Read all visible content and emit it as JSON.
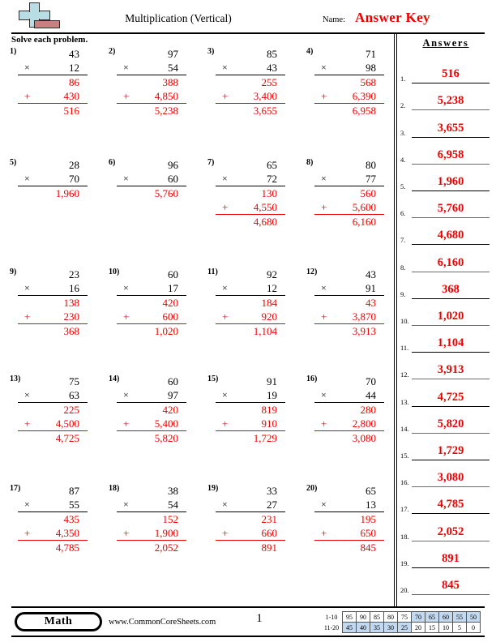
{
  "header": {
    "title": "Multiplication (Vertical)",
    "name_label": "Name:",
    "name_value": "Answer Key",
    "instructions": "Solve each problem.",
    "logo_icon": "plus-block-logo"
  },
  "answers_panel": {
    "title": "Answers",
    "items": [
      {
        "index": "1.",
        "value": "516"
      },
      {
        "index": "2.",
        "value": "5,238"
      },
      {
        "index": "3.",
        "value": "3,655"
      },
      {
        "index": "4.",
        "value": "6,958"
      },
      {
        "index": "5.",
        "value": "1,960"
      },
      {
        "index": "6.",
        "value": "5,760"
      },
      {
        "index": "7.",
        "value": "4,680"
      },
      {
        "index": "8.",
        "value": "6,160"
      },
      {
        "index": "9.",
        "value": "368"
      },
      {
        "index": "10.",
        "value": "1,020"
      },
      {
        "index": "11.",
        "value": "1,104"
      },
      {
        "index": "12.",
        "value": "3,913"
      },
      {
        "index": "13.",
        "value": "4,725"
      },
      {
        "index": "14.",
        "value": "5,820"
      },
      {
        "index": "15.",
        "value": "1,729"
      },
      {
        "index": "16.",
        "value": "3,080"
      },
      {
        "index": "17.",
        "value": "4,785"
      },
      {
        "index": "18.",
        "value": "2,052"
      },
      {
        "index": "19.",
        "value": "891"
      },
      {
        "index": "20.",
        "value": "845"
      }
    ]
  },
  "problems": [
    {
      "num": "1)",
      "multiplicand": "43",
      "operator": "×",
      "multiplier": "12",
      "partials": [
        "86",
        "430"
      ],
      "product": "516"
    },
    {
      "num": "2)",
      "multiplicand": "97",
      "operator": "×",
      "multiplier": "54",
      "partials": [
        "388",
        "4,850"
      ],
      "product": "5,238"
    },
    {
      "num": "3)",
      "multiplicand": "85",
      "operator": "×",
      "multiplier": "43",
      "partials": [
        "255",
        "3,400"
      ],
      "product": "3,655"
    },
    {
      "num": "4)",
      "multiplicand": "71",
      "operator": "×",
      "multiplier": "98",
      "partials": [
        "568",
        "6,390"
      ],
      "product": "6,958"
    },
    {
      "num": "5)",
      "multiplicand": "28",
      "operator": "×",
      "multiplier": "70",
      "partials": [],
      "product": "1,960"
    },
    {
      "num": "6)",
      "multiplicand": "96",
      "operator": "×",
      "multiplier": "60",
      "partials": [],
      "product": "5,760"
    },
    {
      "num": "7)",
      "multiplicand": "65",
      "operator": "×",
      "multiplier": "72",
      "partials": [
        "130",
        "4,550"
      ],
      "product": "4,680"
    },
    {
      "num": "8)",
      "multiplicand": "80",
      "operator": "×",
      "multiplier": "77",
      "partials": [
        "560",
        "5,600"
      ],
      "product": "6,160"
    },
    {
      "num": "9)",
      "multiplicand": "23",
      "operator": "×",
      "multiplier": "16",
      "partials": [
        "138",
        "230"
      ],
      "product": "368"
    },
    {
      "num": "10)",
      "multiplicand": "60",
      "operator": "×",
      "multiplier": "17",
      "partials": [
        "420",
        "600"
      ],
      "product": "1,020"
    },
    {
      "num": "11)",
      "multiplicand": "92",
      "operator": "×",
      "multiplier": "12",
      "partials": [
        "184",
        "920"
      ],
      "product": "1,104"
    },
    {
      "num": "12)",
      "multiplicand": "43",
      "operator": "×",
      "multiplier": "91",
      "partials": [
        "43",
        "3,870"
      ],
      "product": "3,913"
    },
    {
      "num": "13)",
      "multiplicand": "75",
      "operator": "×",
      "multiplier": "63",
      "partials": [
        "225",
        "4,500"
      ],
      "product": "4,725"
    },
    {
      "num": "14)",
      "multiplicand": "60",
      "operator": "×",
      "multiplier": "97",
      "partials": [
        "420",
        "5,400"
      ],
      "product": "5,820"
    },
    {
      "num": "15)",
      "multiplicand": "91",
      "operator": "×",
      "multiplier": "19",
      "partials": [
        "819",
        "910"
      ],
      "product": "1,729"
    },
    {
      "num": "16)",
      "multiplicand": "70",
      "operator": "×",
      "multiplier": "44",
      "partials": [
        "280",
        "2,800"
      ],
      "product": "3,080"
    },
    {
      "num": "17)",
      "multiplicand": "87",
      "operator": "×",
      "multiplier": "55",
      "partials": [
        "435",
        "4,350"
      ],
      "product": "4,785"
    },
    {
      "num": "18)",
      "multiplicand": "38",
      "operator": "×",
      "multiplier": "54",
      "partials": [
        "152",
        "1,900"
      ],
      "product": "2,052"
    },
    {
      "num": "19)",
      "multiplicand": "33",
      "operator": "×",
      "multiplier": "27",
      "partials": [
        "231",
        "660"
      ],
      "product": "891"
    },
    {
      "num": "20)",
      "multiplicand": "65",
      "operator": "×",
      "multiplier": "13",
      "partials": [
        "195",
        "650"
      ],
      "product": "845"
    }
  ],
  "plus_sign": "+",
  "footer": {
    "subject_badge": "Math",
    "site": "www.CommonCoreSheets.com",
    "page": "1"
  },
  "grading_scale": {
    "rows": [
      {
        "label": "1-10",
        "cells": [
          {
            "v": "95",
            "shaded": false
          },
          {
            "v": "90",
            "shaded": false
          },
          {
            "v": "85",
            "shaded": false
          },
          {
            "v": "80",
            "shaded": false
          },
          {
            "v": "75",
            "shaded": false
          },
          {
            "v": "70",
            "shaded": true
          },
          {
            "v": "65",
            "shaded": true
          },
          {
            "v": "60",
            "shaded": true
          },
          {
            "v": "55",
            "shaded": true
          },
          {
            "v": "50",
            "shaded": true
          }
        ]
      },
      {
        "label": "11-20",
        "cells": [
          {
            "v": "45",
            "shaded": true
          },
          {
            "v": "40",
            "shaded": true
          },
          {
            "v": "35",
            "shaded": true
          },
          {
            "v": "30",
            "shaded": true
          },
          {
            "v": "25",
            "shaded": true
          },
          {
            "v": "20",
            "shaded": false
          },
          {
            "v": "15",
            "shaded": false
          },
          {
            "v": "10",
            "shaded": false
          },
          {
            "v": "5",
            "shaded": false
          },
          {
            "v": "0",
            "shaded": false
          }
        ]
      }
    ]
  },
  "colors": {
    "answer_red": "#ee0000",
    "shade_blue": "#c2d9f0",
    "logo_blue": "#b9dde4",
    "logo_red": "#c98080"
  }
}
